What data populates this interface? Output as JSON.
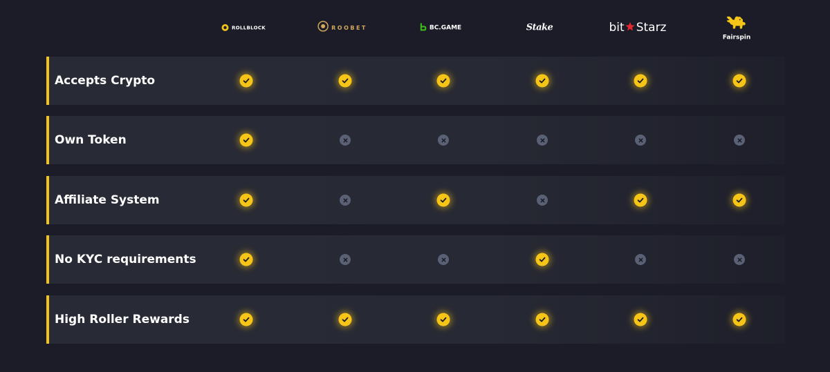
{
  "brands": [
    {
      "id": "rollblock",
      "label": "ROLLBLOCK",
      "icon": "rollblock-logo-icon"
    },
    {
      "id": "roobet",
      "label": "ROOBET",
      "icon": "roobet-logo-icon"
    },
    {
      "id": "bcgame",
      "label": "BC.GAME",
      "icon": "bcgame-logo-icon"
    },
    {
      "id": "stake",
      "label": "Stake",
      "icon": "stake-logo-icon"
    },
    {
      "id": "bitstarz",
      "label_a": "bit",
      "label_b": "Starz",
      "icon": "star-icon"
    },
    {
      "id": "fairspin",
      "label": "Fairspin",
      "icon": "lion-logo-icon"
    }
  ],
  "features": [
    {
      "label": "Accepts Crypto",
      "values": [
        true,
        true,
        true,
        true,
        true,
        true
      ]
    },
    {
      "label": "Own Token",
      "values": [
        true,
        false,
        false,
        false,
        false,
        false
      ]
    },
    {
      "label": "Affiliate System",
      "values": [
        true,
        false,
        true,
        false,
        true,
        true
      ]
    },
    {
      "label": "No KYC requirements",
      "values": [
        true,
        false,
        false,
        true,
        false,
        false
      ]
    },
    {
      "label": "High Roller Rewards",
      "values": [
        true,
        true,
        true,
        true,
        true,
        true
      ]
    }
  ],
  "icons": {
    "yes": "checkmark-icon",
    "no": "cross-icon"
  },
  "colors": {
    "background": "#1b1c27",
    "row": "#282a36",
    "accent": "#f0c419",
    "check": "#f7c518",
    "cross": "#5b6175",
    "bitstarz_star": "#e3262f",
    "bcgame_green": "#3bc117",
    "roobet_gold": "#d2a85a",
    "fairspin_gold": "#f5c518"
  }
}
